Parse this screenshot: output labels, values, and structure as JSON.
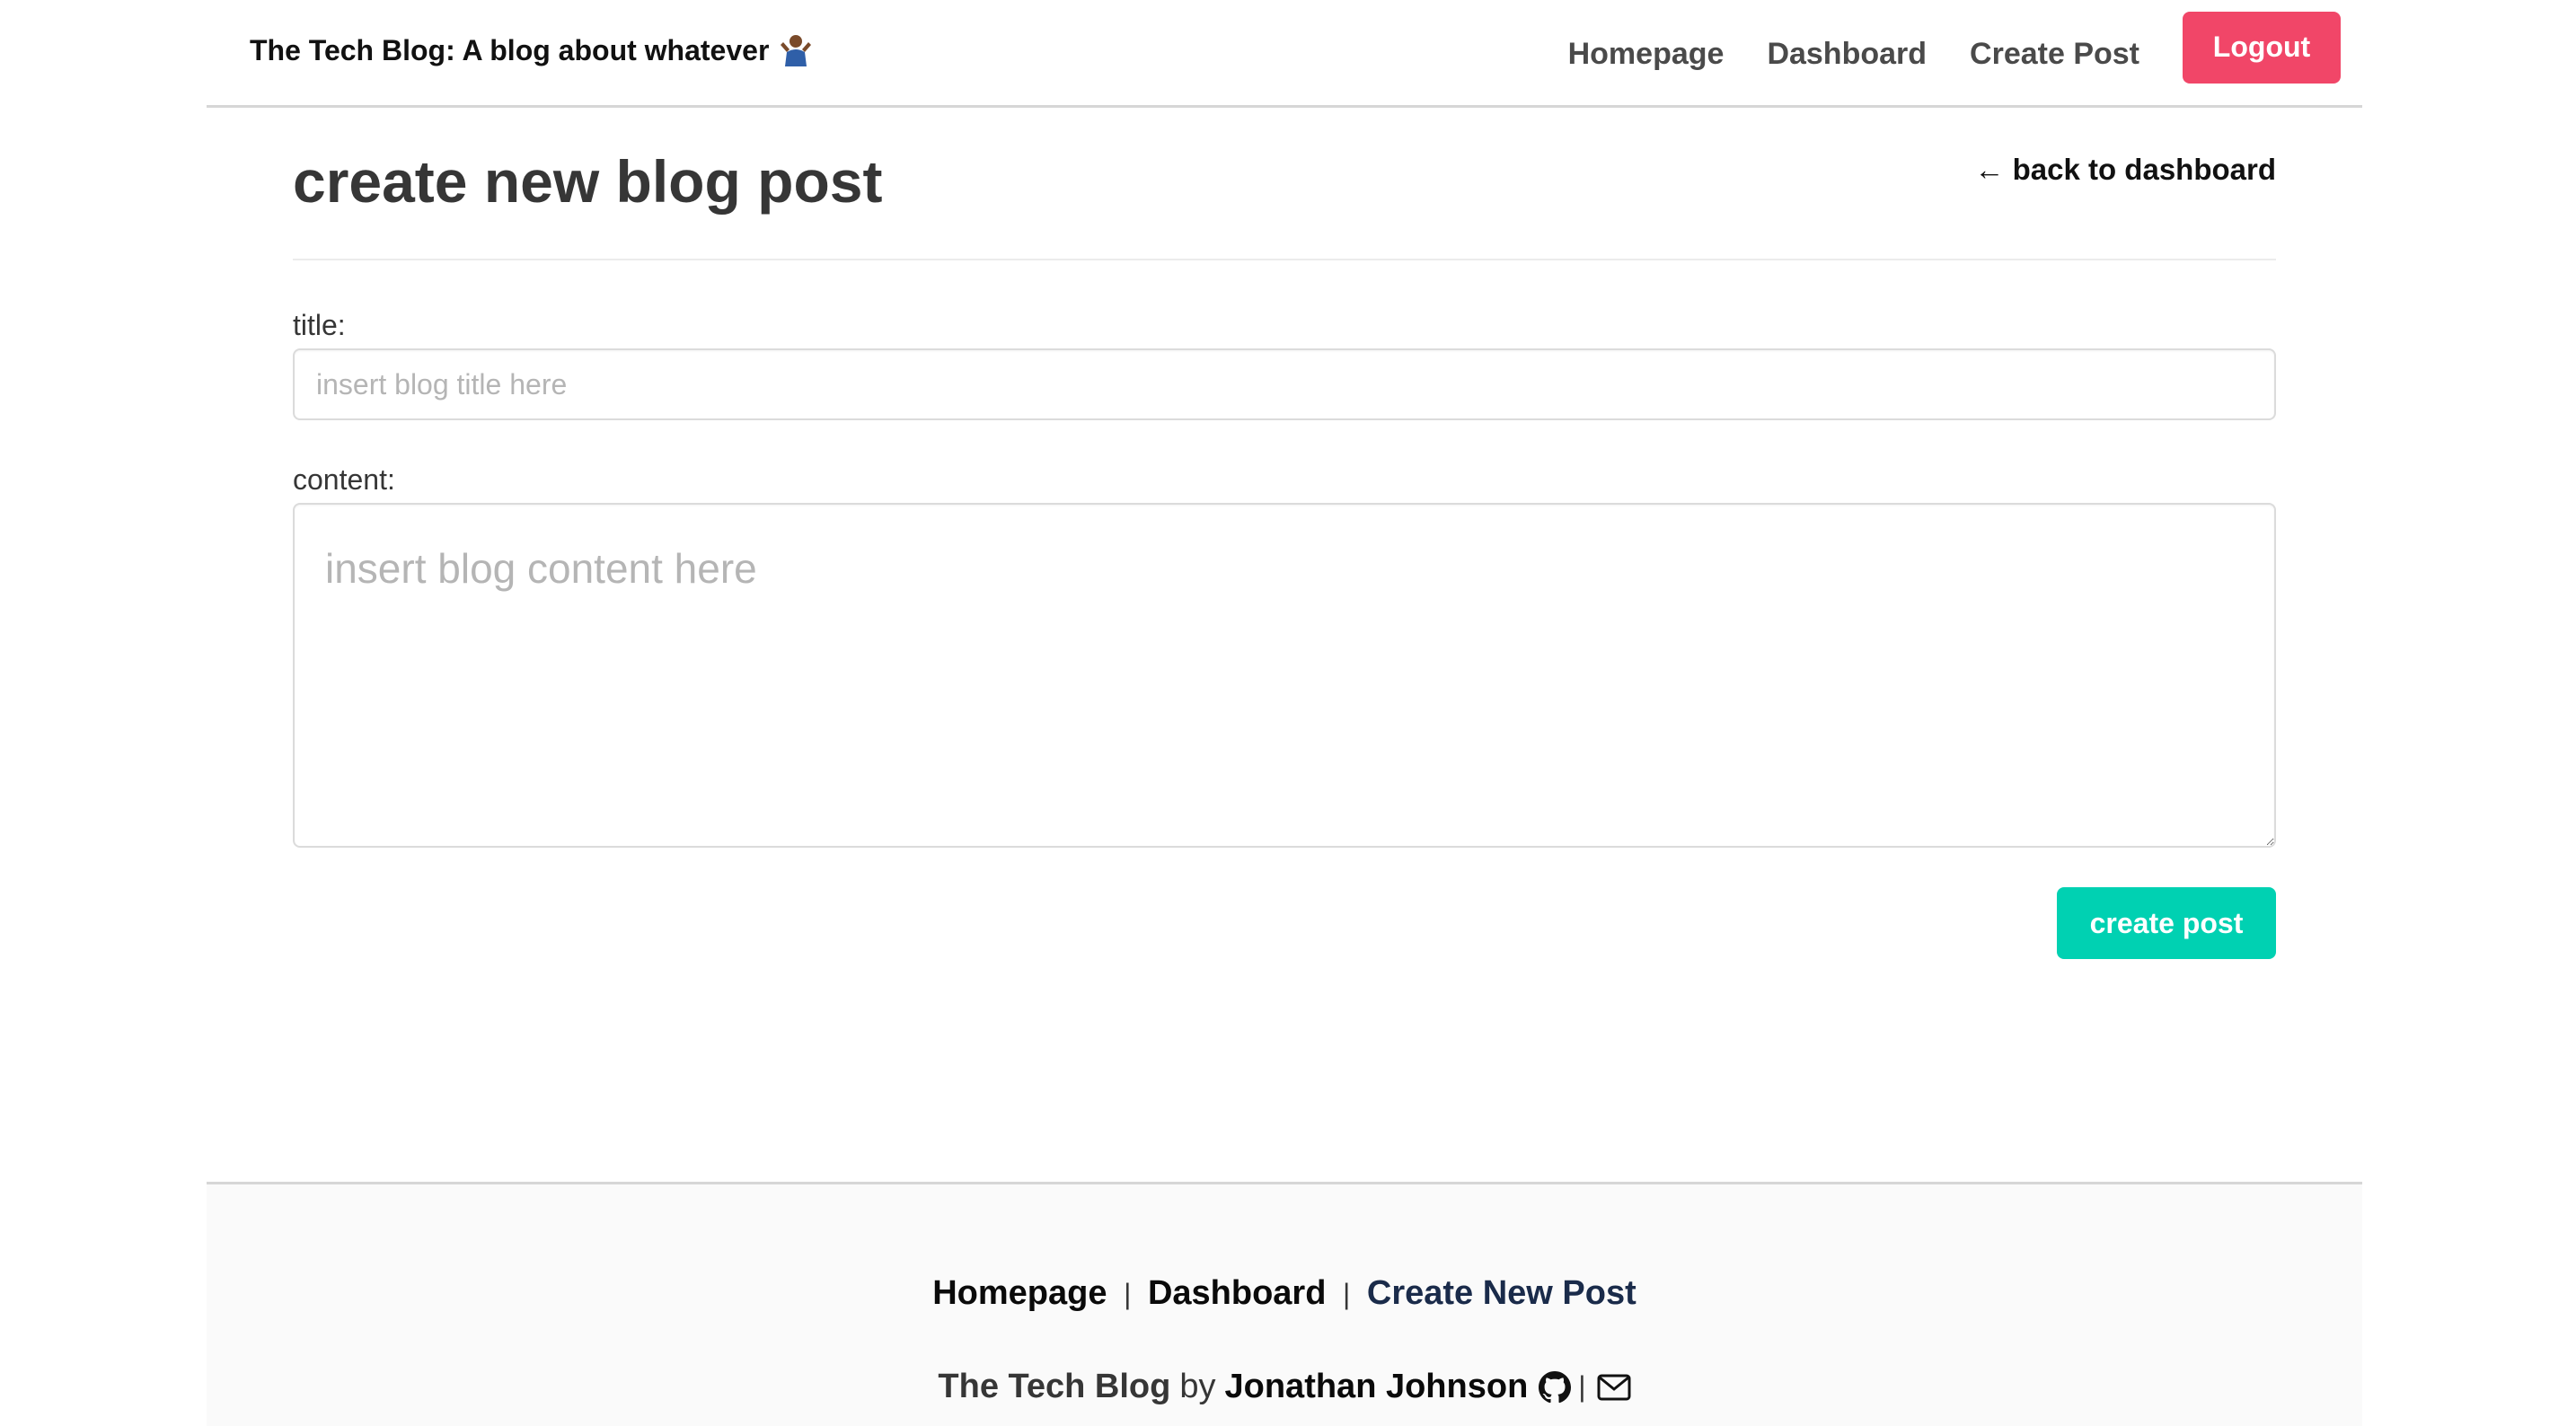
{
  "navbar": {
    "brand": "The Tech Blog: A blog about whatever",
    "brand_icon": "person-shrugging-emoji",
    "links": [
      "Homepage",
      "Dashboard",
      "Create Post"
    ],
    "logout_label": "Logout"
  },
  "main": {
    "page_title": "create new blog post",
    "back_link": "← back to dashboard",
    "title_label": "title:",
    "title_placeholder": "insert blog title here",
    "content_label": "content:",
    "content_placeholder": "insert blog content here",
    "submit_label": "create post"
  },
  "footer": {
    "links": [
      "Homepage",
      "Dashboard",
      "Create New Post"
    ],
    "separator": "|",
    "credit_brand": "The Tech Blog",
    "credit_by": "by",
    "credit_author": "Jonathan Johnson",
    "icons": [
      "github-icon",
      "mail-icon"
    ]
  },
  "colors": {
    "logout": "#f14668",
    "primary": "#00d1b2",
    "active_footer_link": "#1a2b4a"
  }
}
